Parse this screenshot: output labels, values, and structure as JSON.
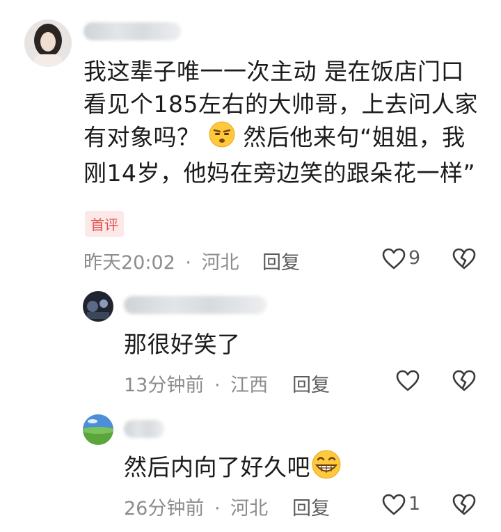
{
  "comment": {
    "content_lines": [
      "我这辈子唯一一次主动 是在饭店门口",
      "看见个185左右的大帅哥，上去问人家",
      "有对象吗？",
      "然后他来句“姐姐，我",
      "刚14岁，他妈在旁边笑的跟朵花一样”"
    ],
    "badge": "首评",
    "time": "昨天20:02",
    "location": "河北",
    "reply_label": "回复",
    "like_count": "9"
  },
  "replies": [
    {
      "content": "那很好笑了",
      "time": "13分钟前",
      "location": "江西",
      "reply_label": "回复",
      "like_count": ""
    },
    {
      "content": "然后内向了好久吧",
      "time": "26分钟前",
      "location": "河北",
      "reply_label": "回复",
      "like_count": "1"
    }
  ],
  "separator": "·",
  "icons": [
    "heart-outline-icon",
    "broken-heart-icon",
    "unamused-emoji-icon",
    "grinning-emoji-icon"
  ],
  "colors": {
    "badge_bg": "#fde8e8",
    "badge_text": "#e0524f",
    "meta": "#8c8c8c"
  }
}
